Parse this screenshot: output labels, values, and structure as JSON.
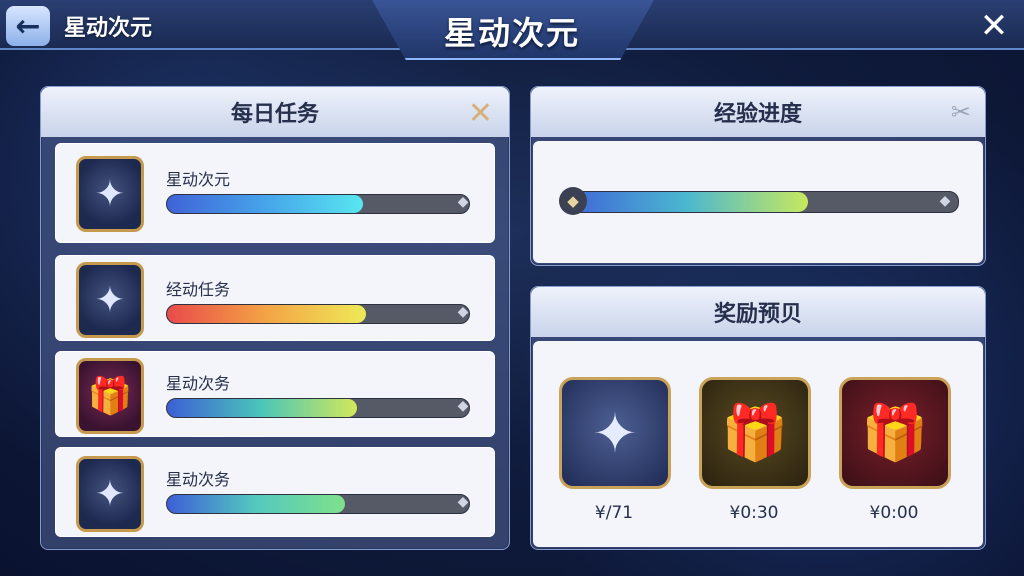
{
  "header": {
    "back_label": "星动次元",
    "title": "星动次元",
    "back_icon": "←",
    "close_icon": "✕"
  },
  "daily_tasks": {
    "title": "每日任务",
    "close_icon": "✕",
    "items": [
      {
        "label": "星动次元",
        "progress": 0.65,
        "icon": "✦",
        "gradient": "linear-gradient(90deg,#3f63d8,#47a4ea,#58e6f0)",
        "end_icon": "◆"
      },
      {
        "label": "经动任务",
        "progress": 0.66,
        "icon": "✦",
        "gradient": "linear-gradient(90deg,#e94a4a,#f3a445,#eeea58)",
        "end_icon": "◆"
      },
      {
        "label": "星动次务",
        "progress": 0.63,
        "icon": "🎁",
        "gradient": "linear-gradient(90deg,#3d5fd6,#4bc6b8,#d2e85a)",
        "end_icon": "◆"
      },
      {
        "label": "星动次务",
        "progress": 0.59,
        "icon": "✦",
        "gradient": "linear-gradient(90deg,#3d5fd6,#54c9be,#7ee18b)",
        "end_icon": "◆"
      }
    ]
  },
  "experience": {
    "title": "经验进度",
    "tools_icon": "✂",
    "progress": 0.62,
    "start_icon": "◆",
    "end_icon": "◆",
    "gradient": "linear-gradient(90deg,#3f63d8,#4bb7cf,#c7e85e)"
  },
  "rewards": {
    "title": "奖励预贝",
    "items": [
      {
        "price": "¥/71",
        "icon": "✦"
      },
      {
        "price": "¥0:30",
        "icon": "🎁"
      },
      {
        "price": "¥0:00",
        "icon": "🎁"
      }
    ]
  }
}
